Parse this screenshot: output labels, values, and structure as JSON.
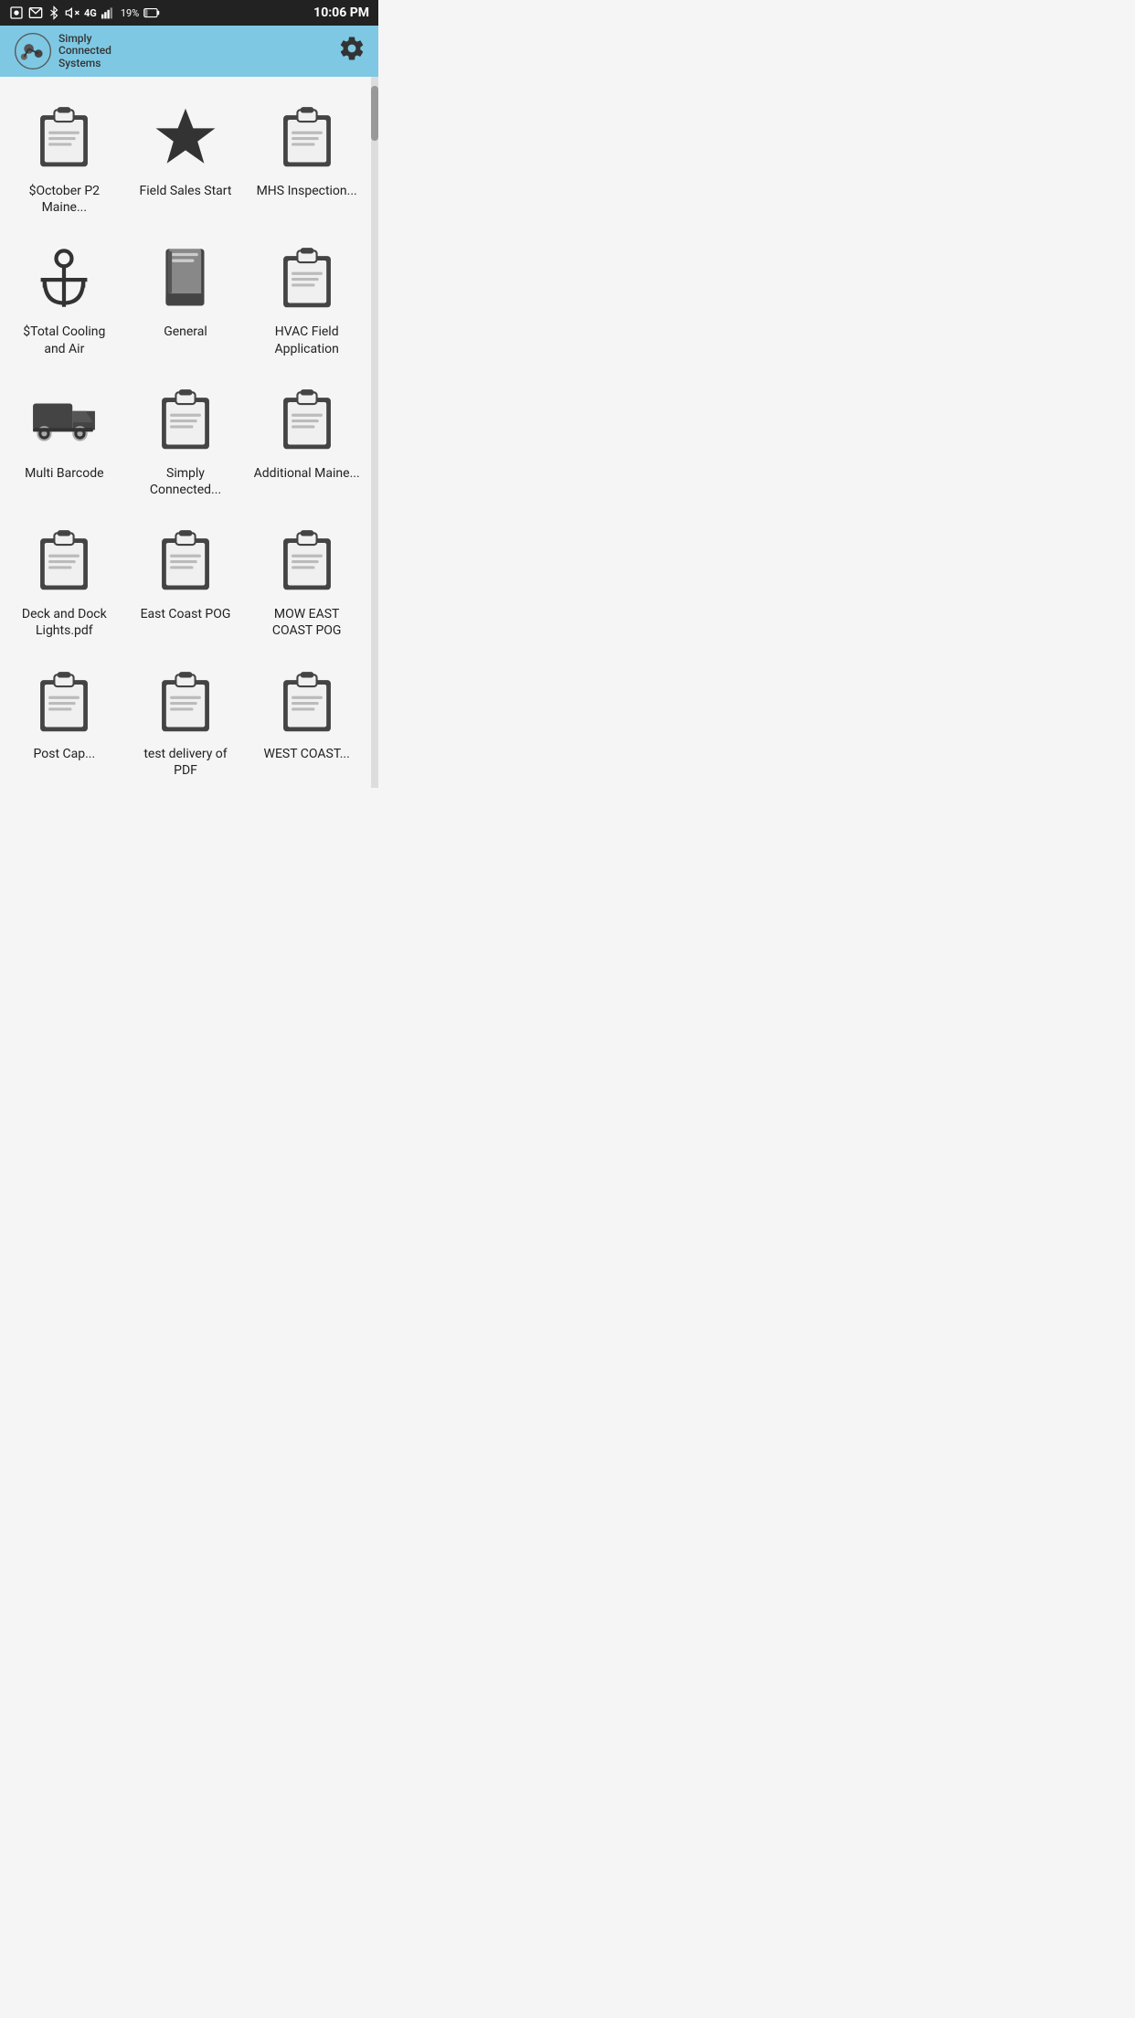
{
  "statusBar": {
    "time": "10:06 PM",
    "battery": "19%",
    "signal": "4G LTE",
    "icons": [
      "photo",
      "mail",
      "bluetooth",
      "mute",
      "signal",
      "battery"
    ]
  },
  "appBar": {
    "appName": "Simply Connected Systems",
    "settingsLabel": "Settings"
  },
  "grid": {
    "items": [
      {
        "id": "october-p2-maine",
        "label": "$October P2 Maine...",
        "iconType": "clipboard"
      },
      {
        "id": "field-sales-start",
        "label": "Field Sales Start",
        "iconType": "star"
      },
      {
        "id": "mhs-inspection",
        "label": "MHS Inspection...",
        "iconType": "clipboard"
      },
      {
        "id": "total-cooling-air",
        "label": "$Total Cooling and Air",
        "iconType": "anchor"
      },
      {
        "id": "general",
        "label": "General",
        "iconType": "book"
      },
      {
        "id": "hvac-field-application",
        "label": "HVAC Field Application",
        "iconType": "clipboard"
      },
      {
        "id": "multi-barcode",
        "label": "Multi Barcode",
        "iconType": "truck"
      },
      {
        "id": "simply-connected",
        "label": "Simply Connected...",
        "iconType": "clipboard"
      },
      {
        "id": "additional-maine",
        "label": "Additional Maine...",
        "iconType": "clipboard"
      },
      {
        "id": "deck-dock-lights",
        "label": "Deck and Dock Lights.pdf",
        "iconType": "clipboard"
      },
      {
        "id": "east-coast-pog",
        "label": "East Coast POG",
        "iconType": "clipboard"
      },
      {
        "id": "mow-east-coast-pog",
        "label": "MOW EAST COAST POG",
        "iconType": "clipboard"
      },
      {
        "id": "post-cap",
        "label": "Post Cap...",
        "iconType": "clipboard",
        "partial": true
      },
      {
        "id": "test-delivery",
        "label": "test delivery of PDF",
        "iconType": "clipboard",
        "partial": true
      },
      {
        "id": "west-coast",
        "label": "WEST COAST...",
        "iconType": "clipboard",
        "partial": true
      }
    ]
  }
}
